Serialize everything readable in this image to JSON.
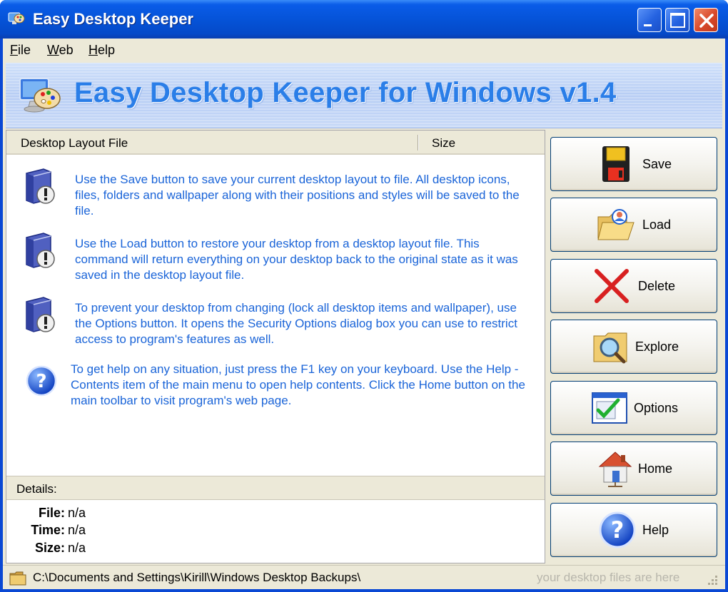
{
  "window": {
    "title": "Easy Desktop Keeper",
    "controls": [
      "minimize-icon",
      "maximize-icon",
      "close-icon"
    ]
  },
  "menu": [
    "File",
    "Web",
    "Help"
  ],
  "banner": {
    "title": "Easy Desktop Keeper for Windows v1.4",
    "icon": "desktop-palette-icon"
  },
  "list": {
    "columns": [
      "Desktop Layout File",
      "Size"
    ],
    "tips": [
      {
        "icon": "info-book-icon",
        "text": "Use the Save button to save your current desktop layout to file. All desktop icons, files, folders and wallpaper along with their positions and styles will be saved to the file."
      },
      {
        "icon": "info-book-icon",
        "text": "Use the Load button to restore your desktop from a desktop layout file. This command will return everything on your desktop back to the original state as it was saved in the desktop layout file."
      },
      {
        "icon": "info-book-icon",
        "text": "To prevent your desktop from changing (lock all desktop items and wallpaper), use the Options button. It opens the Security Options dialog box you can use to restrict access to program's features as well."
      },
      {
        "icon": "help-icon",
        "text": "To get help on any situation, just press the F1 key on your keyboard. Use the Help - Contents item of the main menu to open help contents. Click the Home button on the main toolbar to visit program's web page."
      }
    ]
  },
  "details": {
    "title": "Details:",
    "rows": [
      {
        "label": "File:",
        "value": "n/a"
      },
      {
        "label": "Time:",
        "value": "n/a"
      },
      {
        "label": "Size:",
        "value": "n/a"
      }
    ]
  },
  "buttons": [
    {
      "label": "Save",
      "icon": "floppy-disk-icon"
    },
    {
      "label": "Load",
      "icon": "folder-open-icon"
    },
    {
      "label": "Delete",
      "icon": "red-x-icon"
    },
    {
      "label": "Explore",
      "icon": "folder-search-icon"
    },
    {
      "label": "Options",
      "icon": "checkbox-window-icon"
    },
    {
      "label": "Home",
      "icon": "home-icon"
    },
    {
      "label": "Help",
      "icon": "help-icon"
    }
  ],
  "status": {
    "path": "C:\\Documents and Settings\\Kirill\\Windows Desktop Backups\\",
    "hint": "your desktop files are here"
  },
  "colors": {
    "titlebar": "#0552d6",
    "banner_text": "#2a7ee8",
    "tip_text": "#1a64d8",
    "face": "#ece9d8"
  }
}
